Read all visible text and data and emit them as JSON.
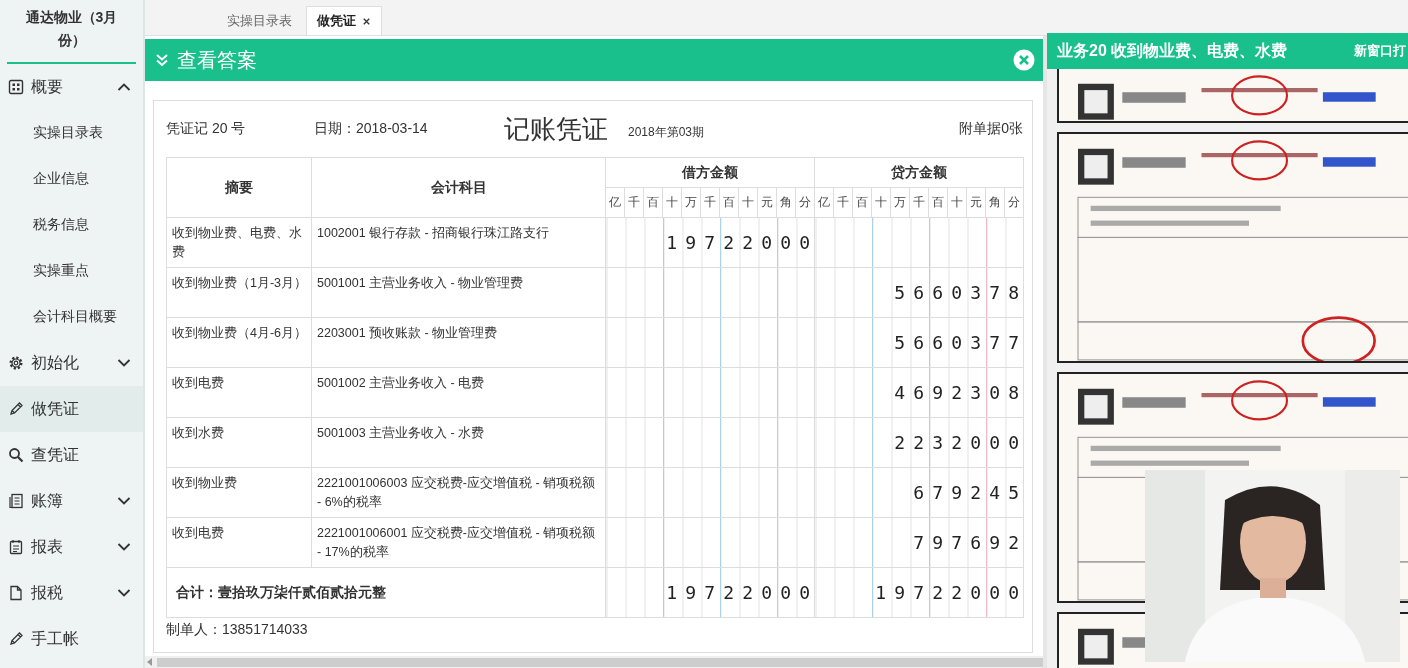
{
  "sidebar": {
    "title": "通达物业（3月份）",
    "items": [
      {
        "kind": "group",
        "label": "概要",
        "selected": false,
        "expanded": true,
        "children": [
          {
            "label": "实操目录表",
            "selected": false
          },
          {
            "label": "企业信息",
            "selected": false
          },
          {
            "label": "税务信息",
            "selected": false
          },
          {
            "label": "实操重点",
            "selected": false
          },
          {
            "label": "会计科目概要",
            "selected": false
          }
        ]
      },
      {
        "kind": "group",
        "label": "初始化",
        "selected": false,
        "expanded": false
      },
      {
        "kind": "link",
        "label": "做凭证",
        "selected": true
      },
      {
        "kind": "link",
        "label": "查凭证",
        "selected": false
      },
      {
        "kind": "group",
        "label": "账簿",
        "selected": false,
        "expanded": false
      },
      {
        "kind": "group",
        "label": "报表",
        "selected": false,
        "expanded": false
      },
      {
        "kind": "group",
        "label": "报税",
        "selected": false,
        "expanded": false
      },
      {
        "kind": "link",
        "label": "手工帐",
        "selected": false
      }
    ]
  },
  "tabs": [
    {
      "label": "实操目录表",
      "selected": false,
      "closable": false
    },
    {
      "label": "做凭证",
      "selected": true,
      "closable": true
    }
  ],
  "answer_panel": {
    "title": "查看答案",
    "voucher": {
      "number": "凭证记 20 号",
      "date": "日期：2018-03-14",
      "title": "记账凭证",
      "period": "2018年第03期",
      "attachments": "附单据0张",
      "columns": {
        "summary": "摘要",
        "account": "会计科目",
        "debit": "借方金额",
        "credit": "贷方金额"
      },
      "debit_units": [
        "亿",
        "千",
        "百",
        "十",
        "万",
        "千",
        "百",
        "十",
        "元",
        "角",
        "分"
      ],
      "credit_units": [
        "亿",
        "千",
        "百",
        "十",
        "万",
        "千",
        "百",
        "十",
        "元",
        "角",
        "分"
      ],
      "entries": [
        {
          "summary": "收到物业费、电费、水费",
          "account": "1002001 银行存款 - 招商银行珠江路支行",
          "debit": "19722000"
        },
        {
          "summary": "收到物业费（1月-3月）",
          "account": "5001001 主营业务收入 - 物业管理费",
          "credit": "5660378"
        },
        {
          "summary": "收到物业费（4月-6月）",
          "account": "2203001 预收账款 - 物业管理费",
          "credit": "5660377"
        },
        {
          "summary": "收到电费",
          "account": "5001002 主营业务收入 - 电费",
          "credit": "4692308"
        },
        {
          "summary": "收到水费",
          "account": "5001003 主营业务收入 - 水费",
          "credit": "2232000"
        },
        {
          "summary": "收到物业费",
          "account": "2221001006003 应交税费-应交增值税 - 销项税额 - 6%的税率",
          "credit": "679245"
        },
        {
          "summary": "收到电费",
          "account": "2221001006001 应交税费-应交增值税 - 销项税额 - 17%的税率",
          "credit": "797692"
        }
      ],
      "total": {
        "text": "合计：壹拾玖万柒仟贰佰贰拾元整",
        "debit": "19722000",
        "credit": "19722000"
      },
      "preparer": "制单人：13851714033"
    }
  },
  "reference_panel": {
    "title": "业务20 收到物业费、电费、水费",
    "open_link": "新窗口打"
  }
}
